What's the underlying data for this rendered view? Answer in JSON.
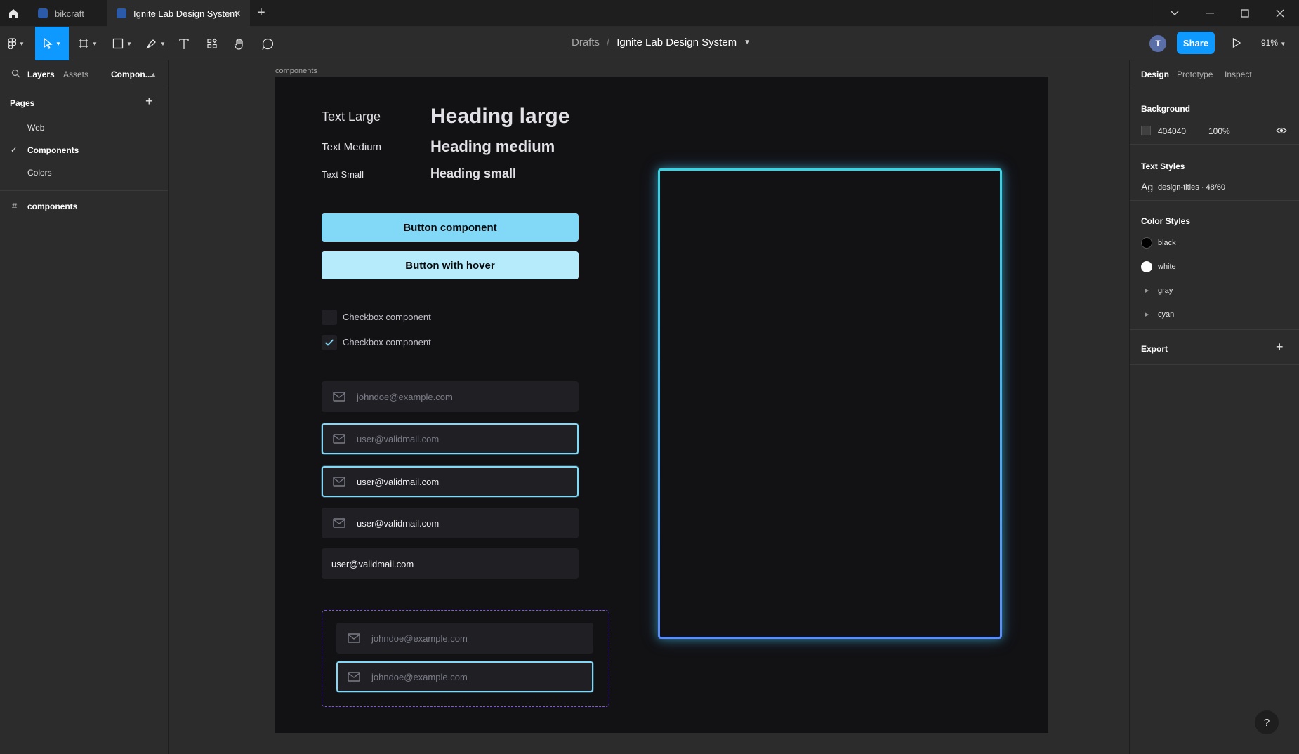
{
  "tabs": [
    {
      "label": "bikcraft",
      "active": false
    },
    {
      "label": "Ignite Lab Design System",
      "active": true
    }
  ],
  "toolbar": {
    "breadcrumb_parent": "Drafts",
    "breadcrumb_sep": "/",
    "file_name": "Ignite Lab Design System",
    "avatar_initial": "T",
    "share_label": "Share",
    "zoom": "91%"
  },
  "left_panel": {
    "tab_layers": "Layers",
    "tab_assets": "Assets",
    "tab_components": "Compon...",
    "pages_title": "Pages",
    "pages": [
      "Web",
      "Components",
      "Colors"
    ],
    "current_page": "Components",
    "layers": [
      "components"
    ]
  },
  "right_panel": {
    "tab_design": "Design",
    "tab_prototype": "Prototype",
    "tab_inspect": "Inspect",
    "background_title": "Background",
    "background_hex": "404040",
    "background_opacity": "100%",
    "text_styles_title": "Text Styles",
    "text_style_ag": "Ag",
    "text_style_name": "design-titles · 48/60",
    "color_styles_title": "Color Styles",
    "color_styles": [
      {
        "name": "black",
        "color": "#000000"
      },
      {
        "name": "white",
        "color": "#ffffff"
      },
      {
        "name": "gray",
        "color": null
      },
      {
        "name": "cyan",
        "color": null
      }
    ],
    "export_title": "Export"
  },
  "canvas": {
    "frame_label": "components",
    "text_rows": [
      {
        "label": "Text Large",
        "heading": "Heading large"
      },
      {
        "label": "Text Medium",
        "heading": "Heading medium"
      },
      {
        "label": "Text Small",
        "heading": "Heading small"
      }
    ],
    "buttons": [
      {
        "label": "Button component",
        "color": "#81d8f7"
      },
      {
        "label": "Button with hover",
        "color": "#b5ebfb"
      }
    ],
    "checkboxes": [
      {
        "label": "Checkbox component",
        "checked": false
      },
      {
        "label": "Checkbox component",
        "checked": true
      }
    ],
    "inputs": [
      {
        "text": "johndoe@example.com",
        "placeholder": true
      },
      {
        "text": "user@validmail.com",
        "placeholder": true
      },
      {
        "text": "user@validmail.com",
        "placeholder": false
      },
      {
        "text": "user@validmail.com",
        "placeholder": false
      },
      {
        "text": "user@validmail.com",
        "placeholder": false
      }
    ],
    "grouped_inputs": [
      {
        "text": "johndoe@example.com"
      },
      {
        "text": "johndoe@example.com"
      }
    ]
  },
  "colors": {
    "accent": "#0d99ff",
    "cyan": "#81d8f7",
    "purple_dashed": "#8257e5",
    "frame_bg": "#121214"
  },
  "help_label": "?"
}
